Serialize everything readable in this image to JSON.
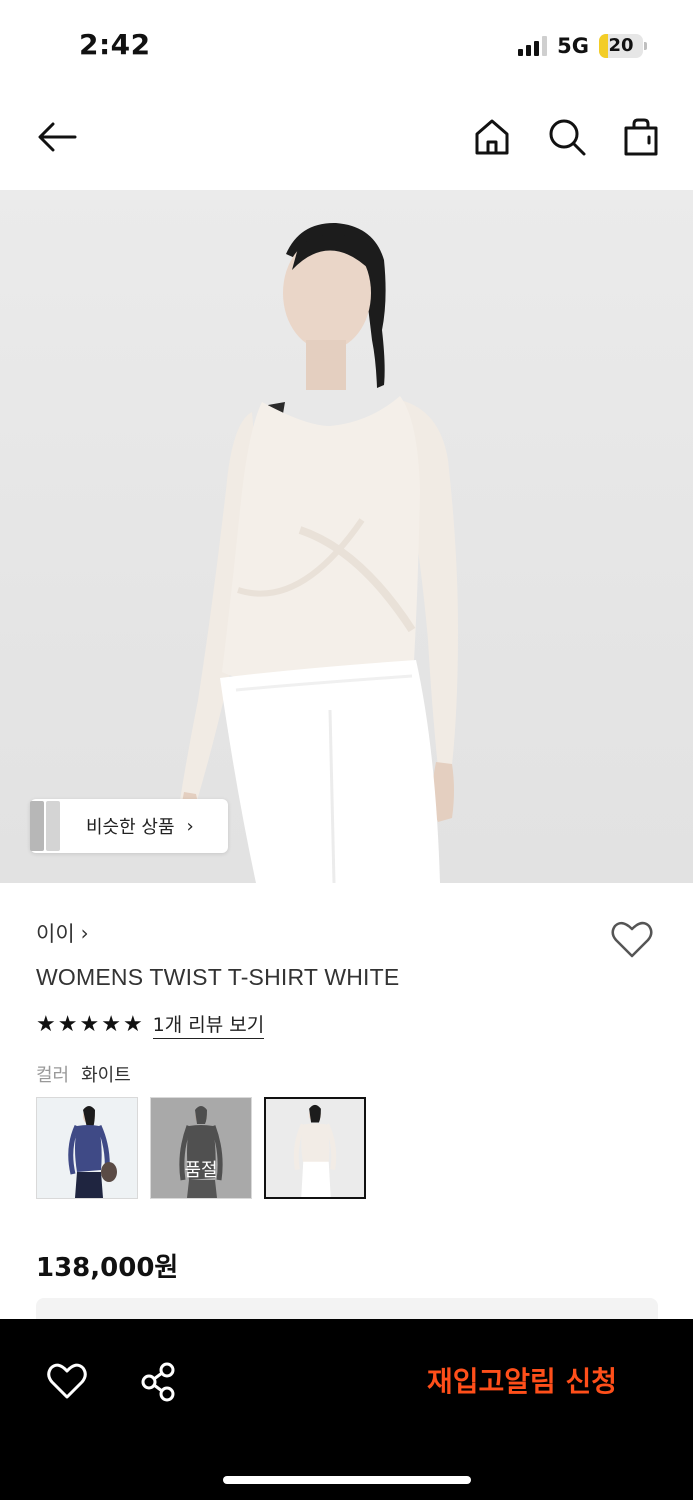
{
  "status_bar": {
    "time": "2:42",
    "network": "5G",
    "battery": "20",
    "battery_level": 0.2,
    "battery_color": "#f3cd27",
    "signal_icon": "signal-bars-icon"
  },
  "nav": {
    "back_icon": "arrow-left-icon",
    "home_icon": "home-icon",
    "search_icon": "search-icon",
    "bag_icon": "shopping-bag-icon"
  },
  "hero": {
    "similar_label": "비슷한 상품",
    "similar_arrow": "›"
  },
  "product": {
    "brand": "이이",
    "brand_arrow": "›",
    "name": "WOMENS TWIST T-SHIRT WHITE",
    "rating": 5,
    "stars": [
      "★",
      "★",
      "★",
      "★",
      "★"
    ],
    "review_link": "1개 리뷰 보기",
    "color_label": "컬러",
    "color_value": "화이트",
    "swatches": [
      {
        "color": "#3f4a86",
        "soldout": false,
        "selected": false
      },
      {
        "color": "#1f1f1f",
        "soldout": true,
        "soldout_label": "품절",
        "selected": false
      },
      {
        "color": "#f2ece6",
        "soldout": false,
        "selected": true
      }
    ],
    "price": "138,000원"
  },
  "bottom_bar": {
    "wishlist_icon": "heart-icon",
    "share_icon": "share-icon",
    "restock_label": "재입고알림 신청",
    "accent_color": "#ff4f1a"
  }
}
